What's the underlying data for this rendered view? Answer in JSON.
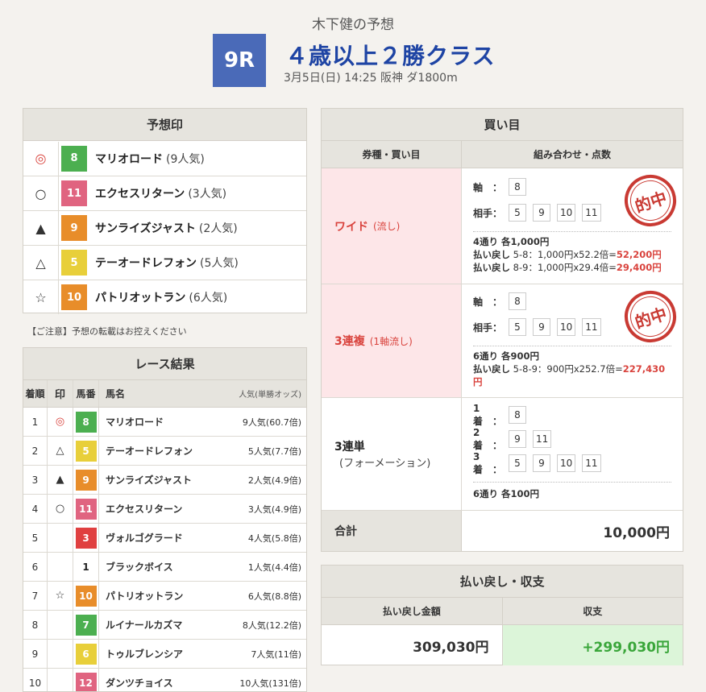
{
  "header": {
    "author": "木下健の予想",
    "race_no": "9R",
    "race_title": "４歳以上２勝クラス",
    "race_info": "3月5日(日) 14:25 阪神 ダ1800m"
  },
  "prediction": {
    "title": "予想印",
    "items": [
      {
        "mark": "◎",
        "num": "8",
        "color": "#4caf50",
        "name": "マリオロード",
        "pop": "(9人気)"
      },
      {
        "mark": "○",
        "num": "11",
        "color": "#e06480",
        "name": "エクセスリターン",
        "pop": "(3人気)"
      },
      {
        "mark": "▲",
        "num": "9",
        "color": "#e88d2a",
        "name": "サンライズジャスト",
        "pop": "(2人気)"
      },
      {
        "mark": "△",
        "num": "5",
        "color": "#e8cf3a",
        "name": "テーオードレフォン",
        "pop": "(5人気)"
      },
      {
        "mark": "☆",
        "num": "10",
        "color": "#e88d2a",
        "name": "パトリオットラン",
        "pop": "(6人気)"
      }
    ],
    "note": "【ご注意】予想の転載はお控えください"
  },
  "results": {
    "title": "レース結果",
    "headers": {
      "rank": "着順",
      "mark": "印",
      "num": "馬番",
      "name": "馬名",
      "pop": "人気(単勝オッズ)"
    },
    "rows": [
      {
        "rank": "1",
        "mark": "◎",
        "num": "8",
        "color": "#4caf50",
        "tc": "#fff",
        "name": "マリオロード",
        "pop": "9人気(60.7倍)"
      },
      {
        "rank": "2",
        "mark": "△",
        "num": "5",
        "color": "#e8cf3a",
        "tc": "#fff",
        "name": "テーオードレフォン",
        "pop": "5人気(7.7倍)"
      },
      {
        "rank": "3",
        "mark": "▲",
        "num": "9",
        "color": "#e88d2a",
        "tc": "#fff",
        "name": "サンライズジャスト",
        "pop": "2人気(4.9倍)"
      },
      {
        "rank": "4",
        "mark": "○",
        "num": "11",
        "color": "#e06480",
        "tc": "#fff",
        "name": "エクセスリターン",
        "pop": "3人気(4.9倍)"
      },
      {
        "rank": "5",
        "mark": "",
        "num": "3",
        "color": "#e04040",
        "tc": "#fff",
        "name": "ヴォルゴグラード",
        "pop": "4人気(5.8倍)"
      },
      {
        "rank": "6",
        "mark": "",
        "num": "1",
        "color": "#ffffff",
        "tc": "#222",
        "name": "ブラックボイス",
        "pop": "1人気(4.4倍)"
      },
      {
        "rank": "7",
        "mark": "☆",
        "num": "10",
        "color": "#e88d2a",
        "tc": "#fff",
        "name": "パトリオットラン",
        "pop": "6人気(8.8倍)"
      },
      {
        "rank": "8",
        "mark": "",
        "num": "7",
        "color": "#4caf50",
        "tc": "#fff",
        "name": "ルイナールカズマ",
        "pop": "8人気(12.2倍)"
      },
      {
        "rank": "9",
        "mark": "",
        "num": "6",
        "color": "#e8cf3a",
        "tc": "#fff",
        "name": "トゥルブレンシア",
        "pop": "7人気(11倍)"
      },
      {
        "rank": "10",
        "mark": "",
        "num": "12",
        "color": "#e06480",
        "tc": "#fff",
        "name": "ダンツチョイス",
        "pop": "10人気(131倍)"
      }
    ]
  },
  "bets": {
    "title": "買い目",
    "head_left": "券種・買い目",
    "head_right": "組み合わせ・点数",
    "stamp": "的中",
    "wide": {
      "type": "ワイド",
      "sub": "(流し)",
      "axis_label": "軸　：",
      "axis": [
        "8"
      ],
      "partner_label": "相手：",
      "partners": [
        "5",
        "9",
        "10",
        "11"
      ],
      "count": "4通り 各1,000円",
      "pay1_prefix": "払い戻し",
      "pay1_body": " 5-8：1,000円x52.2倍=",
      "pay1_amount": "52,200円",
      "pay2_prefix": "払い戻し",
      "pay2_body": " 8-9：1,000円x29.4倍=",
      "pay2_amount": "29,400円"
    },
    "trio": {
      "type": "3連複",
      "sub": "(1軸流し)",
      "axis_label": "軸　：",
      "axis": [
        "8"
      ],
      "partner_label": "相手：",
      "partners": [
        "5",
        "9",
        "10",
        "11"
      ],
      "count": "6通り 各900円",
      "pay1_prefix": "払い戻し",
      "pay1_body": " 5-8-9：900円x252.7倍=",
      "pay1_amount": "227,430円"
    },
    "trifecta": {
      "type": "3連単",
      "sub": "(フォーメーション)",
      "l1": "1着　：",
      "v1": [
        "8"
      ],
      "l2": "2着　：",
      "v2": [
        "9",
        "11"
      ],
      "l3": "3着　：",
      "v3": [
        "5",
        "9",
        "10",
        "11"
      ],
      "count": "6通り 各100円"
    },
    "total_label": "合計",
    "total_value": "10,000円"
  },
  "returns": {
    "title": "払い戻し・収支",
    "head_amount": "払い戻し金額",
    "head_balance": "収支",
    "amount": "309,030円",
    "balance": "+299,030円"
  }
}
